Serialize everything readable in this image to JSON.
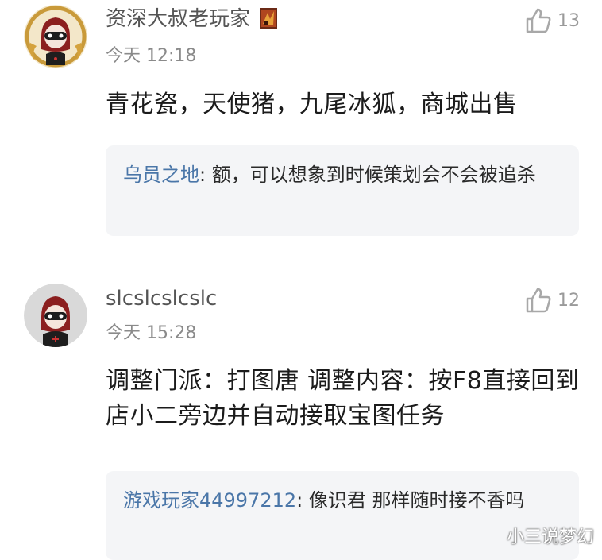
{
  "comments": [
    {
      "username": "资深大叔老玩家",
      "time": "今天 12:18",
      "likes": "13",
      "text": "青花瓷，天使猪，九尾冰狐，商城出售",
      "reply": {
        "name": "乌员之地",
        "text": ": 额，可以想象到时候策划会不会被追杀"
      },
      "avatar_icon": "masked-character-with-gold-frame-avatar",
      "badge_icon": "level-badge-icon"
    },
    {
      "username": "slcslcslcslc",
      "time": "今天 15:28",
      "likes": "12",
      "text": "调整门派：打图唐 调整内容：按F8直接回到店小二旁边并自动接取宝图任务",
      "reply": {
        "name": "游戏玩家44997212",
        "text": ": 像识君 那样随时接不香吗"
      },
      "avatar_icon": "masked-character-avatar"
    }
  ],
  "watermark": "小三说梦幻",
  "colors": {
    "reply_name": "#4a76a8",
    "reply_bg": "#f4f5f7",
    "meta": "#8a8a8a"
  }
}
